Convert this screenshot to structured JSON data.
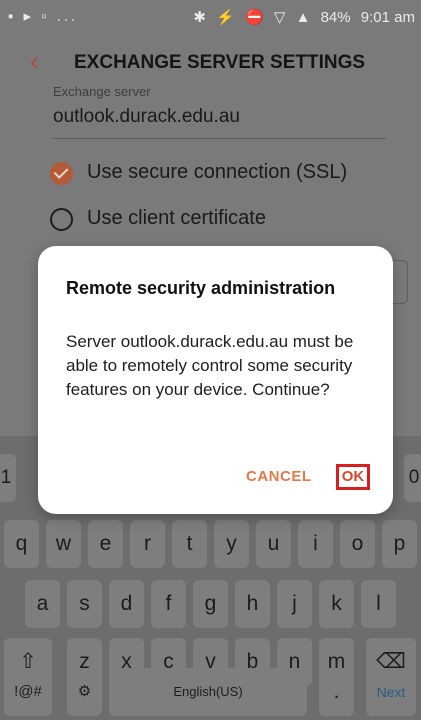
{
  "status_bar": {
    "left_icons": "▪ ▸ ▫ ...",
    "right_icons": [
      "✱",
      "⚡",
      "⛔",
      "▽",
      "▲"
    ],
    "battery": "84%",
    "time": "9:01 am"
  },
  "app_bar": {
    "back_icon": "chevron-left",
    "title": "EXCHANGE SERVER SETTINGS"
  },
  "form": {
    "exchange_server_label": "Exchange server",
    "exchange_server_value": "outlook.durack.edu.au",
    "ssl_option": {
      "label": "Use secure connection (SSL)",
      "checked": true
    },
    "cert_option": {
      "label": "Use client certificate",
      "checked": false
    }
  },
  "dialog": {
    "title": "Remote security administration",
    "body": "Server outlook.durack.edu.au must be able to remotely control some security features on your device. Continue?",
    "cancel_label": "CANCEL",
    "ok_label": "OK"
  },
  "keyboard": {
    "number_row": [
      "1",
      "0"
    ],
    "row1": [
      "q",
      "w",
      "e",
      "r",
      "t",
      "y",
      "u",
      "i",
      "o",
      "p"
    ],
    "row2": [
      "a",
      "s",
      "d",
      "f",
      "g",
      "h",
      "j",
      "k",
      "l"
    ],
    "row3_letters": [
      "z",
      "x",
      "c",
      "v",
      "b",
      "n",
      "m"
    ],
    "shift_icon": "⇧",
    "backspace_icon": "⌫",
    "symbols_label": "!@#",
    "settings_icon": "⚙",
    "space_label": "English(US)",
    "period_label": ".",
    "next_label": "Next"
  },
  "colors": {
    "accent": "#e07a4b",
    "ok_highlight": "#d62020",
    "checkbox": "#b35a36"
  }
}
